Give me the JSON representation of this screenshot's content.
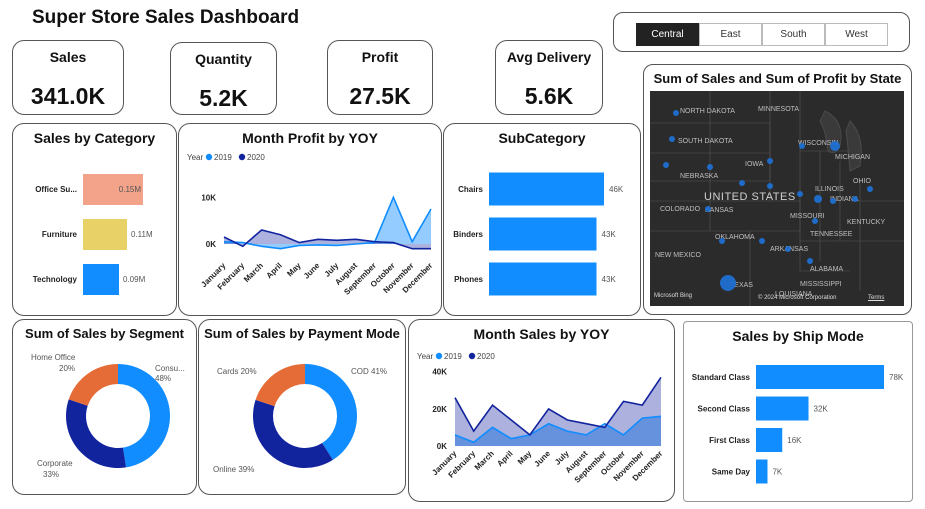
{
  "header": {
    "title": "Super Store Sales Dashboard"
  },
  "slicer": {
    "options": [
      "Central",
      "East",
      "South",
      "West"
    ],
    "selected": "Central"
  },
  "kpis": [
    {
      "label": "Sales",
      "value": "341.0K"
    },
    {
      "label": "Quantity",
      "value": "5.2K"
    },
    {
      "label": "Profit",
      "value": "27.5K"
    },
    {
      "label": "Avg Delivery",
      "value": "5.6K"
    }
  ],
  "colors": {
    "blue": "#118dff",
    "navy": "#12239e",
    "orange": "#e66c37",
    "yellow": "#e8d166",
    "salmon": "#f2a38a",
    "map_bg": "#2b2b2b",
    "map_bubble": "#1f6fd1"
  },
  "map": {
    "title": "Sum of Sales and Sum of Profit by State",
    "country_label": "UNITED STATES",
    "state_labels": [
      "NORTH DAKOTA",
      "SOUTH DAKOTA",
      "NEBRASKA",
      "KANSAS",
      "OKLAHOMA",
      "TEXAS",
      "IOWA",
      "MISSOURI",
      "ILLINOIS",
      "WISCONSIN",
      "MICHIGAN",
      "INDIANA",
      "OHIO",
      "KENTUCKY",
      "TENNESSEE",
      "ARKANSAS",
      "ALABAMA",
      "LOUISIANA",
      "MISSISSIPPI",
      "COLORADO",
      "NEW MEXICO",
      "MINNESOTA"
    ],
    "footer_left": "Microsoft Bing",
    "copyright": "© 2024 Microsoft Corporation",
    "terms": "Terms"
  },
  "chart_data": [
    {
      "id": "sales_by_category",
      "type": "bar",
      "title": "Sales by Category",
      "categories": [
        "Office Su...",
        "Furniture",
        "Technology"
      ],
      "values": [
        0.15,
        0.11,
        0.09
      ],
      "value_labels": [
        "0.15M",
        "0.11M",
        "0.09M"
      ],
      "colors": [
        "#f2a38a",
        "#e8d166",
        "#118dff"
      ]
    },
    {
      "id": "month_profit_yoy",
      "type": "area",
      "title": "Month Profit by YOY",
      "legend_title": "Year",
      "x": [
        "January",
        "February",
        "March",
        "April",
        "May",
        "June",
        "July",
        "August",
        "September",
        "October",
        "November",
        "December"
      ],
      "series": [
        {
          "name": "2019",
          "values": [
            0.5,
            0.3,
            -0.5,
            -1.0,
            -0.3,
            -0.2,
            -0.3,
            0.0,
            0.3,
            10.0,
            0.5,
            7.5
          ]
        },
        {
          "name": "2020",
          "values": [
            1.5,
            -0.5,
            3.0,
            2.0,
            0.3,
            1.0,
            0.8,
            1.0,
            0.5,
            0.3,
            -1.0,
            -1.0
          ]
        }
      ],
      "yticks": [
        "10K",
        "0K"
      ],
      "ylim": [
        -3,
        12
      ]
    },
    {
      "id": "subcategory",
      "type": "bar",
      "title": "SubCategory",
      "categories": [
        "Chairs",
        "Binders",
        "Phones"
      ],
      "values": [
        46,
        43,
        43
      ],
      "value_labels": [
        "46K",
        "43K",
        "43K"
      ]
    },
    {
      "id": "sales_by_segment",
      "type": "pie",
      "title": "Sum of Sales by Segment",
      "labels": [
        "Consu...",
        "Corporate",
        "Home Office"
      ],
      "values": [
        48,
        33,
        20
      ],
      "value_labels": [
        "48%",
        "33%",
        "20%"
      ],
      "colors": [
        "#118dff",
        "#12239e",
        "#e66c37"
      ]
    },
    {
      "id": "sales_by_payment",
      "type": "pie",
      "title": "Sum of Sales by Payment Mode",
      "labels": [
        "COD",
        "Online",
        "Cards"
      ],
      "values": [
        41,
        39,
        20
      ],
      "value_labels": [
        "COD 41%",
        "Online 39%",
        "Cards 20%"
      ],
      "colors": [
        "#118dff",
        "#12239e",
        "#e66c37"
      ]
    },
    {
      "id": "month_sales_yoy",
      "type": "area",
      "title": "Month Sales by YOY",
      "legend_title": "Year",
      "x": [
        "January",
        "February",
        "March",
        "April",
        "May",
        "June",
        "July",
        "August",
        "September",
        "October",
        "November",
        "December"
      ],
      "series": [
        {
          "name": "2019",
          "values": [
            6,
            2,
            10,
            4,
            6,
            12,
            8,
            6,
            12,
            6,
            15,
            16
          ]
        },
        {
          "name": "2020",
          "values": [
            26,
            8,
            22,
            14,
            6,
            20,
            14,
            12,
            10,
            24,
            22,
            37
          ]
        }
      ],
      "yticks": [
        "40K",
        "20K",
        "0K"
      ],
      "ylim": [
        0,
        42
      ]
    },
    {
      "id": "sales_by_ship_mode",
      "type": "bar",
      "title": "Sales by Ship Mode",
      "categories": [
        "Standard Class",
        "Second Class",
        "First Class",
        "Same Day"
      ],
      "values": [
        78,
        32,
        16,
        7
      ],
      "value_labels": [
        "78K",
        "32K",
        "16K",
        "7K"
      ]
    }
  ]
}
